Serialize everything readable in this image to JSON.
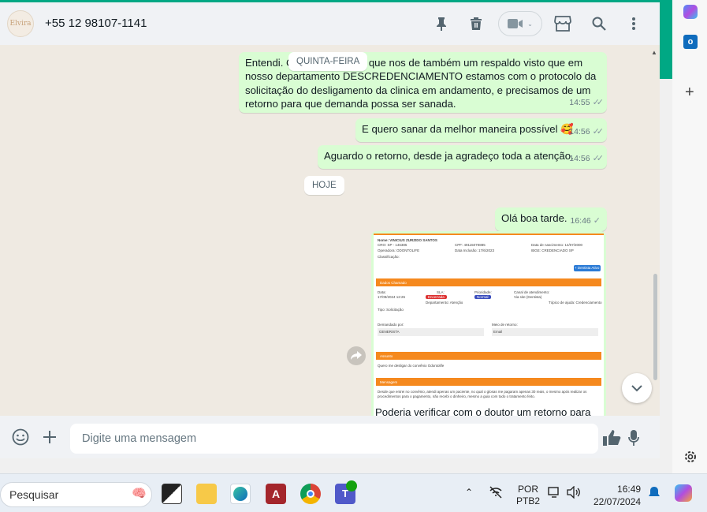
{
  "header": {
    "contact": "+55 12 98107-1141",
    "avatar_text": "Elvira"
  },
  "messages": [
    {
      "text": "Entendi. C                          que nos de também um respaldo visto que em nosso departamento DESCREDENCIAMENTO estamos com o protocolo da solicitação do desligamento da clinica em andamento, e precisamos de um retorno para que demanda possa ser sanada.",
      "time": "14:55"
    },
    {
      "text": "E quero sanar da melhor maneira possível 🥰",
      "time": "14:56"
    },
    {
      "text": "Aguardo o retorno, desde ja agradeço toda a atenção.",
      "time": "14:56"
    },
    {
      "text": "Olá boa tarde.",
      "time": "16:46"
    },
    {
      "text": "Poderia verificar com o doutor um retorno para"
    }
  ],
  "date_chips": {
    "sticky": "QUINTA-FEIRA",
    "today": "HOJE"
  },
  "image": {
    "row1": "Nome: VINICIUS ZURZIDO SANTOS",
    "cpf": "CPF: 49115079885",
    "dob": "Data de nascimento: 14/07/2000",
    "cro": "CRO: SP - 146385",
    "operadora": "Operadora: ODONTOLIFE",
    "inclusao": "Data Inclusão: 17/6/2023",
    "ibge": "IBGE: CREDENCIADO SP",
    "classificacao": "Classificação:",
    "btn": "+ Dentista Ativo",
    "section1": "Dados Chamado",
    "data_label": "Data:",
    "data_value": "17/09/2024 12:26",
    "sla_label": "SLA:",
    "sla_badge": "Encerrada",
    "prio_label": "Prioridade:",
    "prio_badge": "Normal",
    "canal_label": "Canal de atendimento:",
    "canal_value": "Via site (Dentista)",
    "depto": "Departamento: Atenção",
    "topico": "Tópico de ajuda: Credenciamento",
    "tipo": "Tipo: Solicitação",
    "demandado": "Demandado por:",
    "demandado_val": "GENERISTA",
    "meio": "Meio de retorno:",
    "meio_val": "Email",
    "section2": "Assunto",
    "assunto": "Quero me desligar do convênio Odontolife",
    "section3": "Mensagem",
    "mensagem": "Desde que entrei no convênio, atendi apenas um paciente, no qual o glosas me pagaram apenas 30 reais, o mesmo após realizar os procedimentos para o pagamento, não recebi o dinheiro, mesmo a guia com todo o tratamento feito."
  },
  "input": {
    "placeholder": "Digite uma mensagem"
  },
  "taskbar": {
    "search": "Pesquisar",
    "lang": "POR",
    "layout": "PTB2",
    "time": "16:49",
    "date": "22/07/2024"
  },
  "colors": {
    "accent": "#00a884",
    "outgoing": "#d9fdd3",
    "orange": "#f5891e"
  }
}
